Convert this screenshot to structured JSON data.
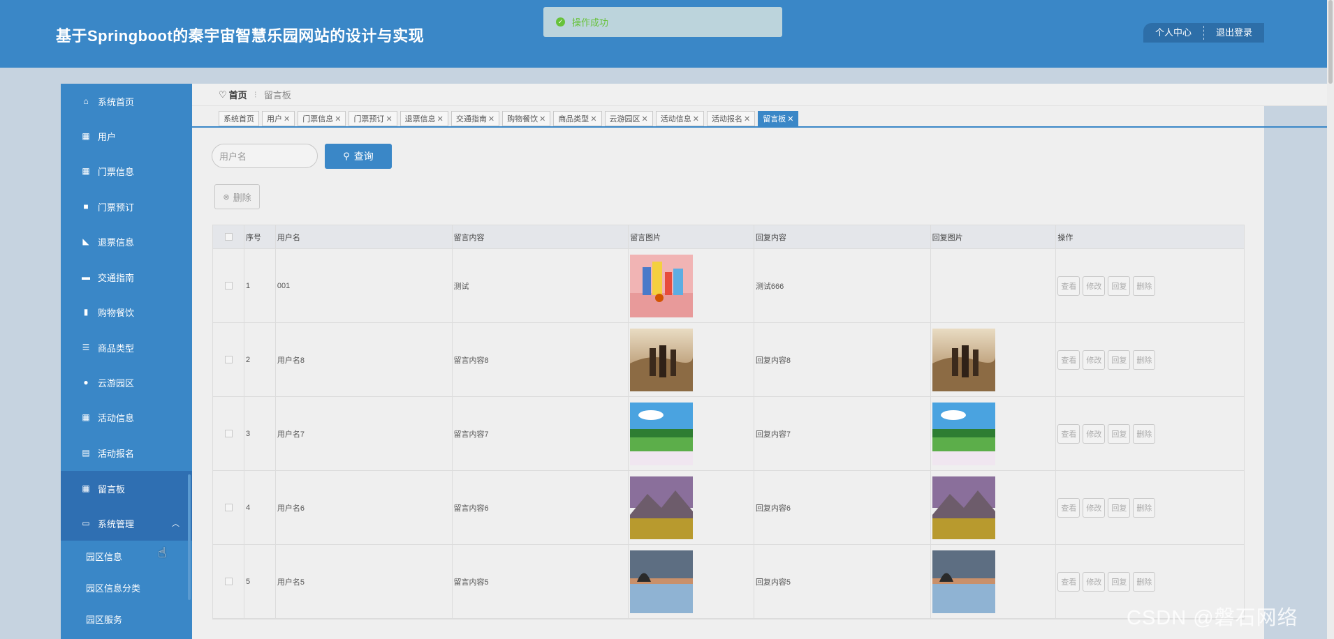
{
  "header": {
    "title": "基于Springboot的秦宇宙智慧乐园网站的设计与实现",
    "profile_label": "个人中心",
    "logout_label": "退出登录"
  },
  "toast": {
    "message": "操作成功"
  },
  "sidebar": {
    "items": [
      {
        "label": "系统首页",
        "icon": "home-icon"
      },
      {
        "label": "用户",
        "icon": "grid-icon"
      },
      {
        "label": "门票信息",
        "icon": "grid-icon"
      },
      {
        "label": "门票预订",
        "icon": "briefcase-icon"
      },
      {
        "label": "退票信息",
        "icon": "hand-icon"
      },
      {
        "label": "交通指南",
        "icon": "ticket-icon"
      },
      {
        "label": "购物餐饮",
        "icon": "bar-chart-icon"
      },
      {
        "label": "商品类型",
        "icon": "list-icon"
      },
      {
        "label": "云游园区",
        "icon": "user-icon"
      },
      {
        "label": "活动信息",
        "icon": "grid-icon"
      },
      {
        "label": "活动报名",
        "icon": "clipboard-icon"
      },
      {
        "label": "留言板",
        "icon": "grid-icon"
      },
      {
        "label": "系统管理",
        "icon": "monitor-icon"
      }
    ],
    "submenu": [
      "园区信息",
      "园区信息分类",
      "园区服务"
    ]
  },
  "breadcrumb": {
    "home": "首页",
    "current": "留言板"
  },
  "tabs": [
    "系统首页",
    "用户",
    "门票信息",
    "门票预订",
    "退票信息",
    "交通指南",
    "购物餐饮",
    "商品类型",
    "云游园区",
    "活动信息",
    "活动报名",
    "留言板"
  ],
  "search": {
    "placeholder": "用户名",
    "button": "查询"
  },
  "delete_button": "删除",
  "table": {
    "headers": [
      "序号",
      "用户名",
      "留言内容",
      "留言图片",
      "回复内容",
      "回复图片",
      "操作"
    ],
    "actions": [
      "查看",
      "修改",
      "回复",
      "删除"
    ],
    "rows": [
      {
        "index": "1",
        "username": "001",
        "content": "测试",
        "reply": "测试666",
        "image": "toys",
        "reply_image": ""
      },
      {
        "index": "2",
        "username": "用户名8",
        "content": "留言内容8",
        "reply": "回复内容8",
        "image": "hikers",
        "reply_image": "hikers"
      },
      {
        "index": "3",
        "username": "用户名7",
        "content": "留言内容7",
        "reply": "回复内容7",
        "image": "meadow",
        "reply_image": "meadow"
      },
      {
        "index": "4",
        "username": "用户名6",
        "content": "留言内容6",
        "reply": "回复内容6",
        "image": "mountains",
        "reply_image": "mountains"
      },
      {
        "index": "5",
        "username": "用户名5",
        "content": "留言内容5",
        "reply": "回复内容5",
        "image": "lake",
        "reply_image": "lake"
      }
    ]
  },
  "watermark": "CSDN @磐石网络"
}
